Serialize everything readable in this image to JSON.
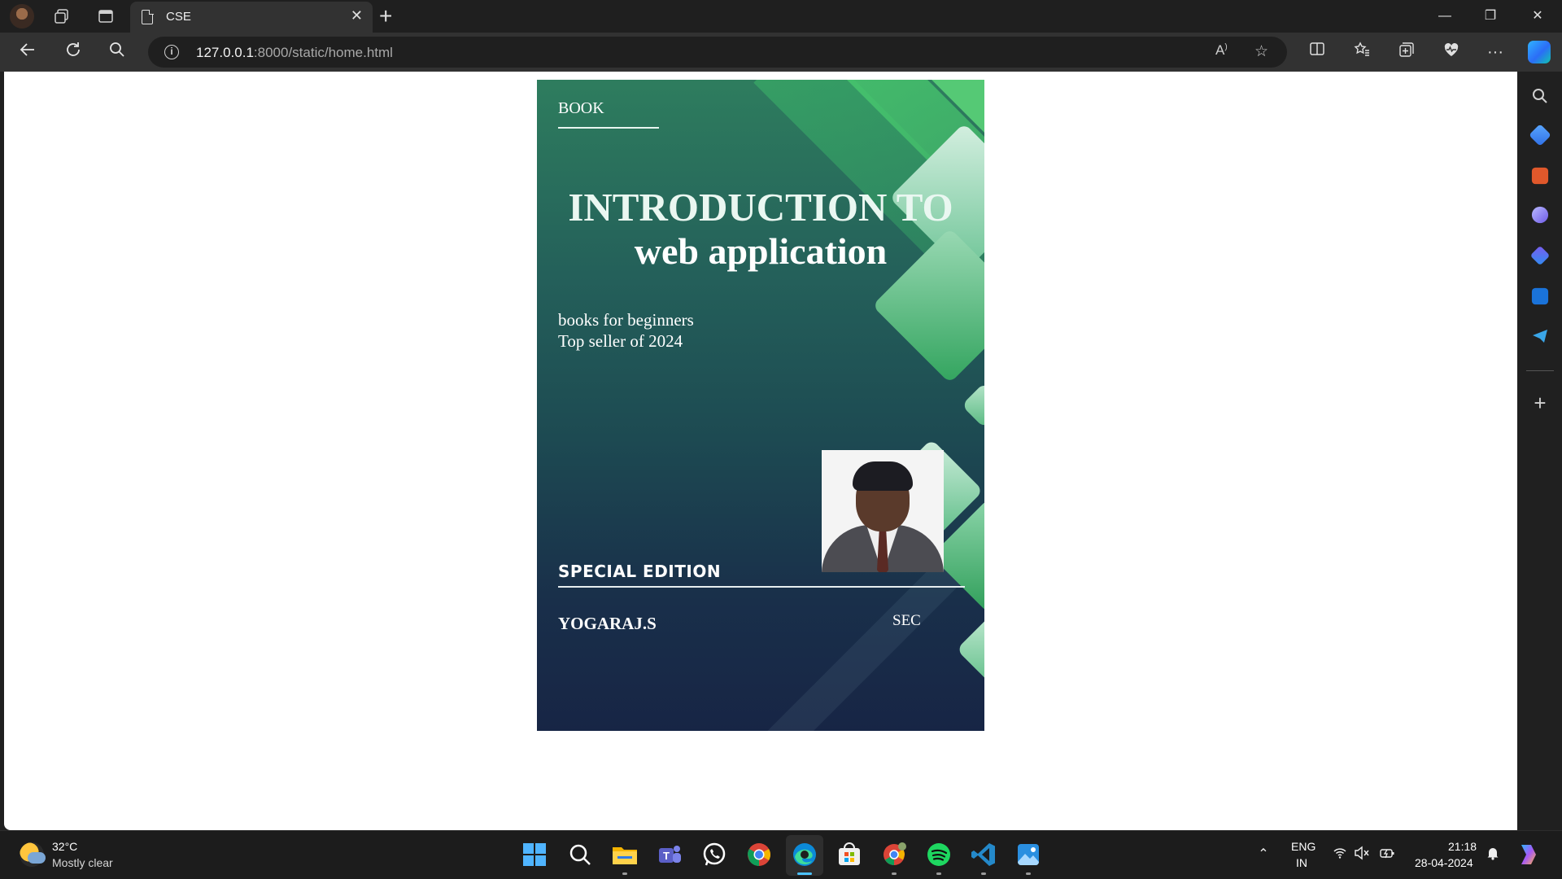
{
  "browser": {
    "tab": {
      "title": "CSE",
      "close_glyph": "✕"
    },
    "new_tab_glyph": "+",
    "window_controls": {
      "minimize": "—",
      "restore": "❐",
      "close": "✕"
    },
    "address": {
      "host": "127.0.0.1",
      "rest": ":8000/static/home.html"
    },
    "read_aloud_glyph": "A",
    "sidebar_add_glyph": "+"
  },
  "book": {
    "label": "BOOK",
    "title_line1": "INTRODUCTION TO",
    "title_line2": "web application",
    "tagline1": "books for beginners",
    "tagline2": "Top seller of 2024",
    "edition": "SPECIAL EDITION",
    "author": "YOGARAJ.S",
    "publisher": "SEC",
    "colors": {
      "top": "#2e7d5e",
      "bottom": "#172545",
      "accent": "#3cb96a"
    }
  },
  "taskbar": {
    "weather": {
      "temperature": "32°C",
      "condition": "Mostly clear"
    },
    "apps": [
      "start-icon",
      "search-icon",
      "file-explorer-icon",
      "teams-icon",
      "whatsapp-icon",
      "chrome-icon",
      "edge-icon",
      "microsoft-store-icon",
      "chrome-profile-icon",
      "spotify-icon",
      "vscode-icon",
      "photos-icon"
    ],
    "tray": {
      "language": "ENG",
      "region": "IN",
      "time": "21:18",
      "date": "28-04-2024"
    }
  }
}
